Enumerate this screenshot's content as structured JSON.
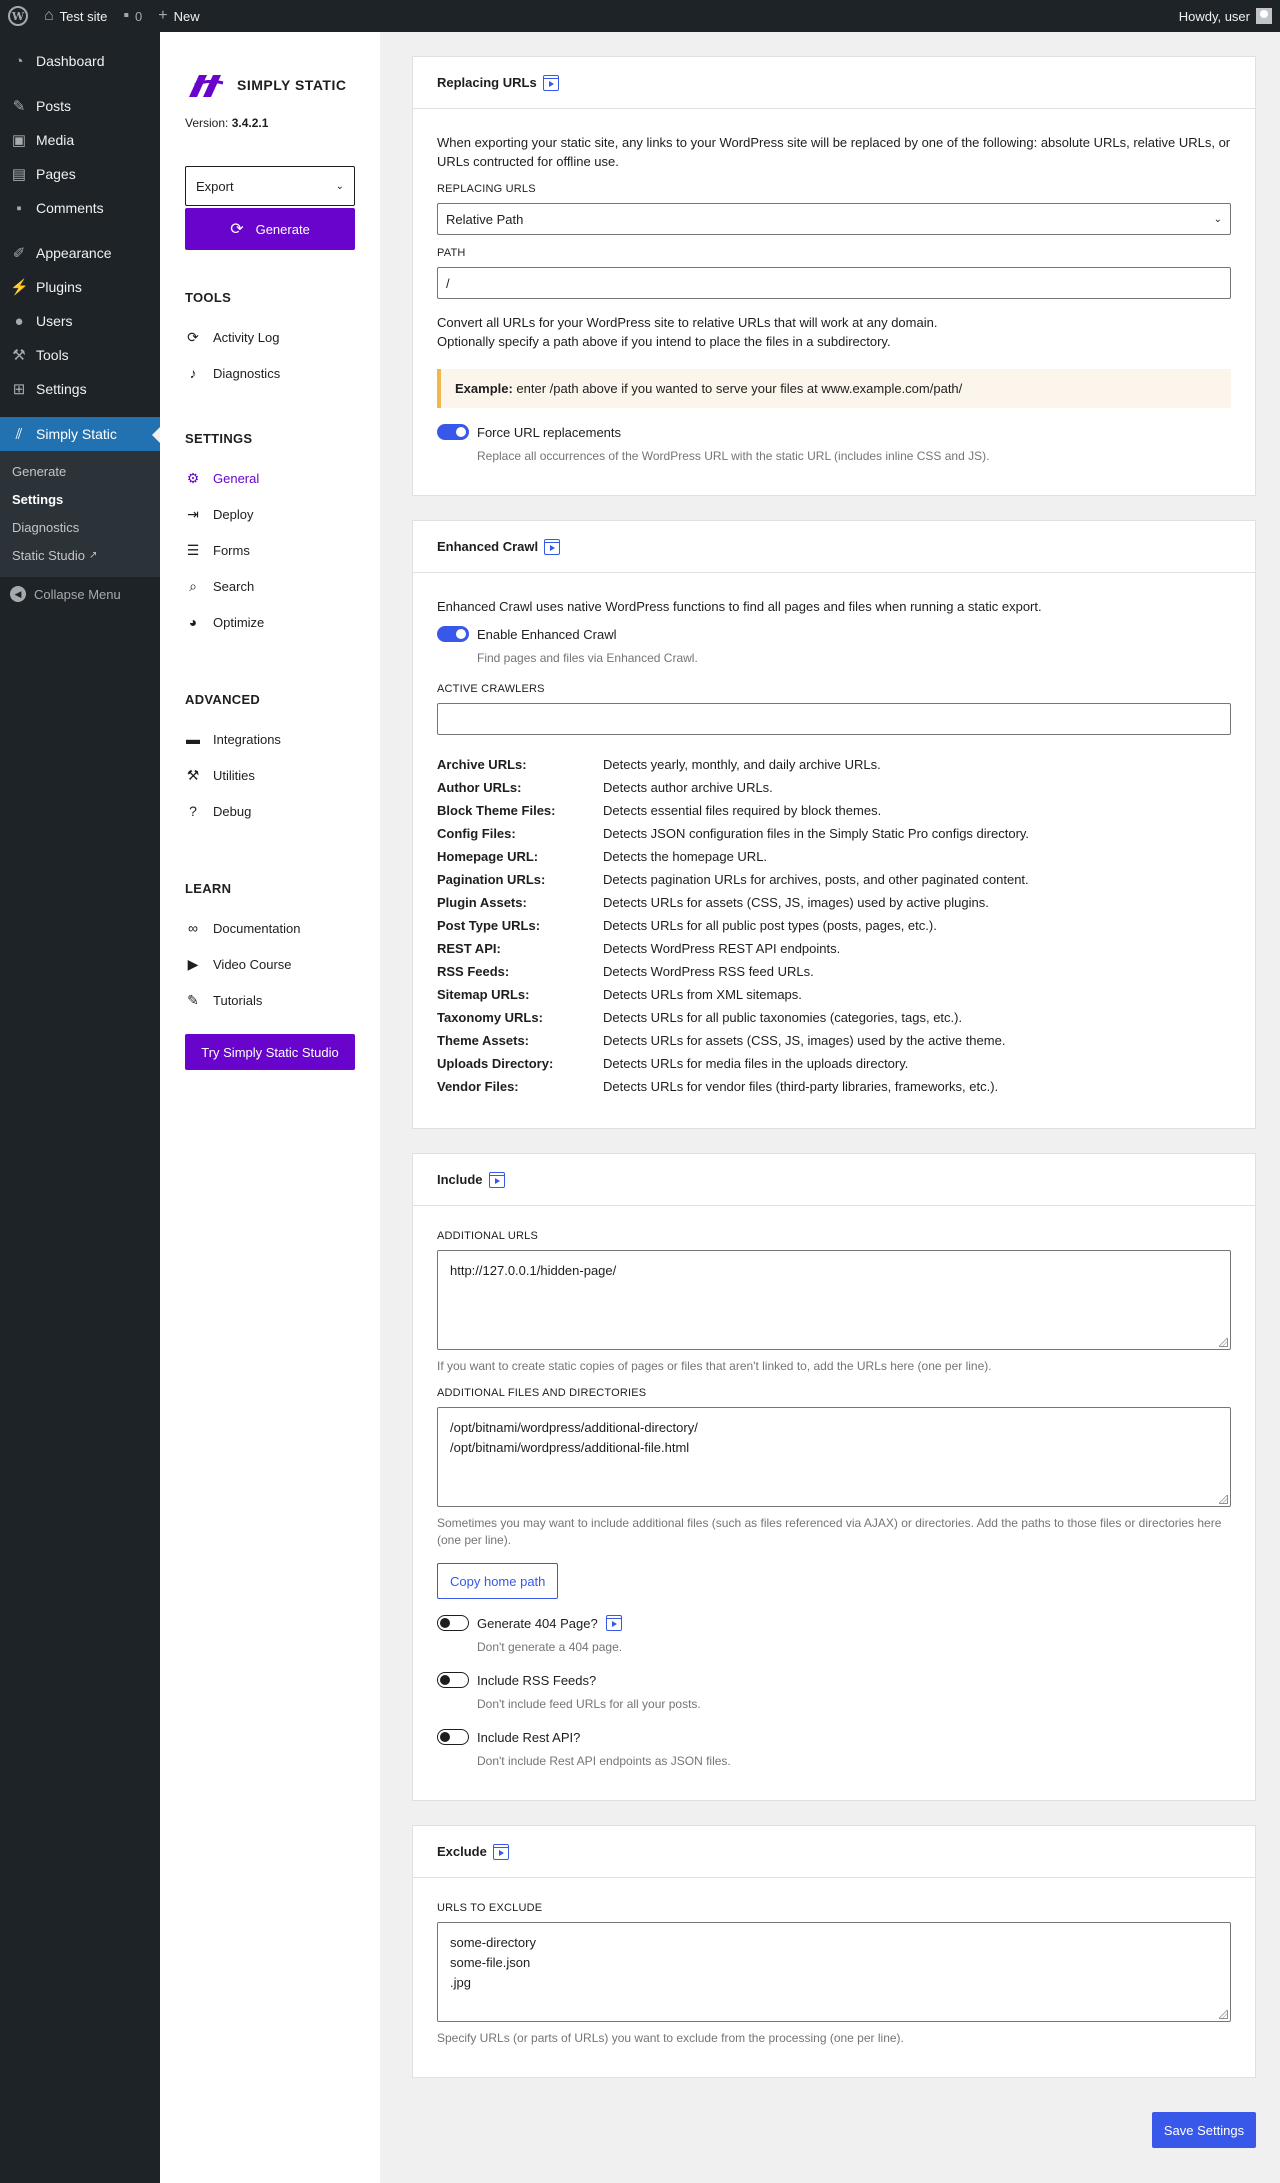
{
  "adminbar": {
    "site_name": "Test site",
    "comments_count": "0",
    "new_label": "New",
    "howdy": "Howdy, user"
  },
  "adminmenu": {
    "items": [
      {
        "label": "Dashboard",
        "icon": "dashboard-icon"
      },
      {
        "label": "Posts",
        "icon": "pin-icon"
      },
      {
        "label": "Media",
        "icon": "media-icon"
      },
      {
        "label": "Pages",
        "icon": "pages-icon"
      },
      {
        "label": "Comments",
        "icon": "comment-icon"
      },
      {
        "label": "Appearance",
        "icon": "brush-icon"
      },
      {
        "label": "Plugins",
        "icon": "plug-icon"
      },
      {
        "label": "Users",
        "icon": "user-icon"
      },
      {
        "label": "Tools",
        "icon": "wrench-icon"
      },
      {
        "label": "Settings",
        "icon": "settings-icon"
      },
      {
        "label": "Simply Static",
        "icon": "simply-static-icon"
      }
    ],
    "submenu": [
      "Generate",
      "Settings",
      "Diagnostics",
      "Static Studio"
    ],
    "collapse_label": "Collapse Menu"
  },
  "plugin_sidebar": {
    "logo_text": "SIMPLY STATIC",
    "version_label": "Version:",
    "version": "3.4.2.1",
    "export_select": "Export",
    "generate_label": "Generate",
    "sections": {
      "tools": "TOOLS",
      "settings": "SETTINGS",
      "advanced": "ADVANCED",
      "learn": "LEARN"
    },
    "tools": [
      "Activity Log",
      "Diagnostics"
    ],
    "settings": [
      "General",
      "Deploy",
      "Forms",
      "Search",
      "Optimize"
    ],
    "advanced": [
      "Integrations",
      "Utilities",
      "Debug"
    ],
    "learn": [
      "Documentation",
      "Video Course",
      "Tutorials"
    ],
    "studio_button": "Try Simply Static Studio"
  },
  "replacing": {
    "title": "Replacing URLs",
    "description": "When exporting your static site, any links to your WordPress site will be replaced by one of the following: absolute URLs, relative URLs, or URLs contructed for offline use.",
    "replacing_label": "REPLACING URLS",
    "replacing_value": "Relative Path",
    "path_label": "PATH",
    "path_value": "/",
    "convert_line1": "Convert all URLs for your WordPress site to relative URLs that will work at any domain.",
    "convert_line2": "Optionally specify a path above if you intend to place the files in a subdirectory.",
    "example_bold": "Example:",
    "example_text": " enter /path above if you wanted to serve your files at www.example.com/path/",
    "force_label": "Force URL replacements",
    "force_help": "Replace all occurrences of the WordPress URL with the static URL (includes inline CSS and JS)."
  },
  "crawl": {
    "title": "Enhanced Crawl",
    "description": "Enhanced Crawl uses native WordPress functions to find all pages and files when running a static export.",
    "enable_label": "Enable Enhanced Crawl",
    "enable_help": "Find pages and files via Enhanced Crawl.",
    "crawlers_label": "ACTIVE CRAWLERS",
    "crawlers": [
      {
        "name": "Archive URLs:",
        "desc": "Detects yearly, monthly, and daily archive URLs."
      },
      {
        "name": "Author URLs:",
        "desc": "Detects author archive URLs."
      },
      {
        "name": "Block Theme Files:",
        "desc": "Detects essential files required by block themes."
      },
      {
        "name": "Config Files:",
        "desc": "Detects JSON configuration files in the Simply Static Pro configs directory."
      },
      {
        "name": "Homepage URL:",
        "desc": "Detects the homepage URL."
      },
      {
        "name": "Pagination URLs:",
        "desc": "Detects pagination URLs for archives, posts, and other paginated content."
      },
      {
        "name": "Plugin Assets:",
        "desc": "Detects URLs for assets (CSS, JS, images) used by active plugins."
      },
      {
        "name": "Post Type URLs:",
        "desc": "Detects URLs for all public post types (posts, pages, etc.)."
      },
      {
        "name": "REST API:",
        "desc": "Detects WordPress REST API endpoints."
      },
      {
        "name": "RSS Feeds:",
        "desc": "Detects WordPress RSS feed URLs."
      },
      {
        "name": "Sitemap URLs:",
        "desc": "Detects URLs from XML sitemaps."
      },
      {
        "name": "Taxonomy URLs:",
        "desc": "Detects URLs for all public taxonomies (categories, tags, etc.)."
      },
      {
        "name": "Theme Assets:",
        "desc": "Detects URLs for assets (CSS, JS, images) used by the active theme."
      },
      {
        "name": "Uploads Directory:",
        "desc": "Detects URLs for media files in the uploads directory."
      },
      {
        "name": "Vendor Files:",
        "desc": "Detects URLs for vendor files (third-party libraries, frameworks, etc.)."
      }
    ]
  },
  "include": {
    "title": "Include",
    "urls_label": "ADDITIONAL URLS",
    "urls_value": [
      "http://127.0.0.1/hidden-page/"
    ],
    "urls_help": "If you want to create static copies of pages or files that aren't linked to, add the URLs here (one per line).",
    "files_label": "ADDITIONAL FILES AND DIRECTORIES",
    "files_value": [
      "/opt/bitnami/wordpress/additional-directory/",
      "/opt/bitnami/wordpress/additional-file.html"
    ],
    "files_help": "Sometimes you may want to include additional files (such as files referenced via AJAX) or directories. Add the paths to those files or directories here (one per line).",
    "copy_button": "Copy home path",
    "gen404_label": "Generate 404 Page?",
    "gen404_help": "Don't generate a 404 page.",
    "rss_label": "Include RSS Feeds?",
    "rss_help": "Don't include feed URLs for all your posts.",
    "rest_label": "Include Rest API?",
    "rest_help": "Don't include Rest API endpoints as JSON files."
  },
  "exclude": {
    "title": "Exclude",
    "urls_label": "URLS TO EXCLUDE",
    "urls_value": [
      "some-directory",
      "some-file.json",
      ".jpg"
    ],
    "urls_help": "Specify URLs (or parts of URLs) you want to exclude from the processing (one per line)."
  },
  "save_label": "Save Settings",
  "colors": {
    "brand": "#6804cc",
    "accent": "#3858e9",
    "wp_blue": "#2271b1",
    "admin_dark": "#1d2327"
  }
}
